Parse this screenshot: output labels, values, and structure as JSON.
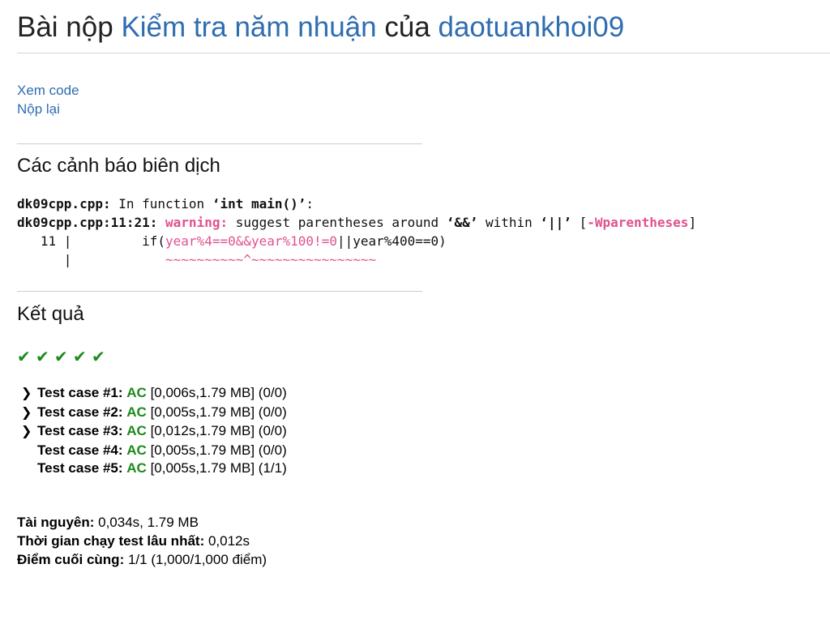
{
  "title": {
    "prefix": "Bài nộp ",
    "problem": "Kiểm tra năm nhuận",
    "middle": " của ",
    "user": "daotuankhoi09"
  },
  "links": {
    "view_code": "Xem code",
    "resubmit": "Nộp lại"
  },
  "warnings_heading": "Các cảnh báo biên dịch",
  "compile_output": {
    "l1_file": "dk09cpp.cpp:",
    "l1_mid": " In function ",
    "l1_fn": "‘int main()’",
    "l1_end": ":",
    "l2_file": "dk09cpp.cpp:11:21:",
    "l2_warning": "warning:",
    "l2_msg1": " suggest parentheses around ",
    "l2_q1": "‘&&’",
    "l2_msg2": " within ",
    "l2_q2": "‘||’",
    "l2_br_open": " [",
    "l2_flag": "-Wparentheses",
    "l2_br_close": "]",
    "l3_lineno": "   11 | ",
    "l3_pre": "        if(",
    "l3_highlight": "year%4==0&&year%100!=0",
    "l3_post": "||year%400==0)",
    "l4_prefix": "      | ",
    "l4_marker": "           ~~~~~~~~~~^~~~~~~~~~~~~~~~~"
  },
  "results_heading": "Kết quả",
  "checkmarks": [
    "✔",
    "✔",
    "✔",
    "✔",
    "✔"
  ],
  "test_cases": [
    {
      "label": "Test case #1:",
      "status": "AC",
      "detail": "[0,006s,1.79 MB] (0/0)",
      "expandable": true
    },
    {
      "label": "Test case #2:",
      "status": "AC",
      "detail": "[0,005s,1.79 MB] (0/0)",
      "expandable": true
    },
    {
      "label": "Test case #3:",
      "status": "AC",
      "detail": "[0,012s,1.79 MB] (0/0)",
      "expandable": true
    },
    {
      "label": "Test case #4:",
      "status": "AC",
      "detail": "[0,005s,1.79 MB] (0/0)",
      "expandable": false
    },
    {
      "label": "Test case #5:",
      "status": "AC",
      "detail": "[0,005s,1.79 MB] (1/1)",
      "expandable": false
    }
  ],
  "summary": {
    "resources_label": "Tài nguyên:",
    "resources_value": " 0,034s, 1.79 MB",
    "max_time_label": "Thời gian chạy test lâu nhất:",
    "max_time_value": " 0,012s",
    "final_score_label": "Điểm cuối cùng:",
    "final_score_value": " 1/1 (1,000/1,000 điểm)"
  },
  "colors": {
    "link": "#2f6db1",
    "ac": "#1a8a1a",
    "warning": "#e0528e"
  }
}
